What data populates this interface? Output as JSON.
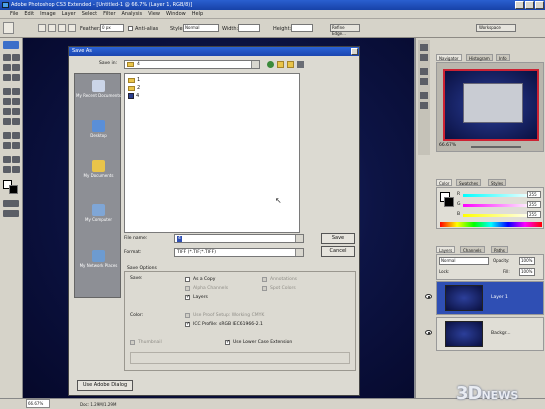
{
  "window": {
    "title": "Adobe Photoshop CS3 Extended - [Untitled-1 @ 66.7% (Layer 1, RGB/8)]"
  },
  "menu": [
    "File",
    "Edit",
    "Image",
    "Layer",
    "Select",
    "Filter",
    "Analysis",
    "View",
    "Window",
    "Help"
  ],
  "options_bar": {
    "feather_label": "Feather:",
    "feather_value": "0 px",
    "antialias_label": "Anti-alias",
    "style_label": "Style:",
    "style_value": "Normal",
    "width_label": "Width:",
    "height_label": "Height:",
    "refine_label": "Refine Edge...",
    "workspace_label": "Workspace"
  },
  "dialog": {
    "title": "Save As",
    "save_in_label": "Save in:",
    "save_in_value": "4",
    "places": [
      "My Recent Documents",
      "Desktop",
      "My Documents",
      "My Computer",
      "My Network Places"
    ],
    "files": [
      {
        "name": "1",
        "type": "folder"
      },
      {
        "name": "2",
        "type": "folder"
      },
      {
        "name": "4",
        "type": "file"
      }
    ],
    "filename_label": "File name:",
    "filename_value": "4",
    "format_label": "Format:",
    "format_value": "TIFF (*.TIF;*.TIFF)",
    "save_button": "Save",
    "cancel_button": "Cancel",
    "save_options_label": "Save Options",
    "save_label": "Save:",
    "as_copy": "As a Copy",
    "alpha_channels": "Alpha Channels",
    "layers": "Layers",
    "annotations": "Annotations",
    "spot_colors": "Spot Colors",
    "color_label": "Color:",
    "use_proof_setup": "Use Proof Setup: Working CMYK",
    "icc_profile": "ICC Profile: sRGB IEC61966-2.1",
    "thumbnail": "Thumbnail",
    "lowercase_ext": "Use Lower Case Extension",
    "adobe_dialog_button": "Use Adobe Dialog"
  },
  "navigator": {
    "tabs": [
      "Navigator",
      "Histogram",
      "Info"
    ],
    "zoom": "66.67%"
  },
  "color_panel": {
    "tabs": [
      "Color",
      "Swatches",
      "Styles"
    ],
    "channels": [
      {
        "label": "R",
        "value": "255",
        "color": "#ff3030"
      },
      {
        "label": "G",
        "value": "255",
        "color": "#30d030"
      },
      {
        "label": "B",
        "value": "255",
        "color": "#3050ff"
      }
    ]
  },
  "layers_panel": {
    "tabs": [
      "Layers",
      "Channels",
      "Paths"
    ],
    "blend_mode": "Normal",
    "opacity_label": "Opacity:",
    "opacity_value": "100%",
    "lock_label": "Lock:",
    "fill_label": "Fill:",
    "fill_value": "100%",
    "layers": [
      {
        "name": "Layer 1",
        "selected": true
      },
      {
        "name": "Backgr...",
        "selected": false
      }
    ]
  },
  "status": {
    "zoom": "66.67%",
    "doc": "Doc: 1.29M/1.29M"
  },
  "watermark": {
    "brand_a": "3D",
    "brand_b": "NEWS"
  },
  "colors": {
    "title_blue": "#1f4fc0",
    "canvas_dark": "#0d1445",
    "chrome": "#d6d3c9",
    "selection": "#2f4fb4"
  }
}
